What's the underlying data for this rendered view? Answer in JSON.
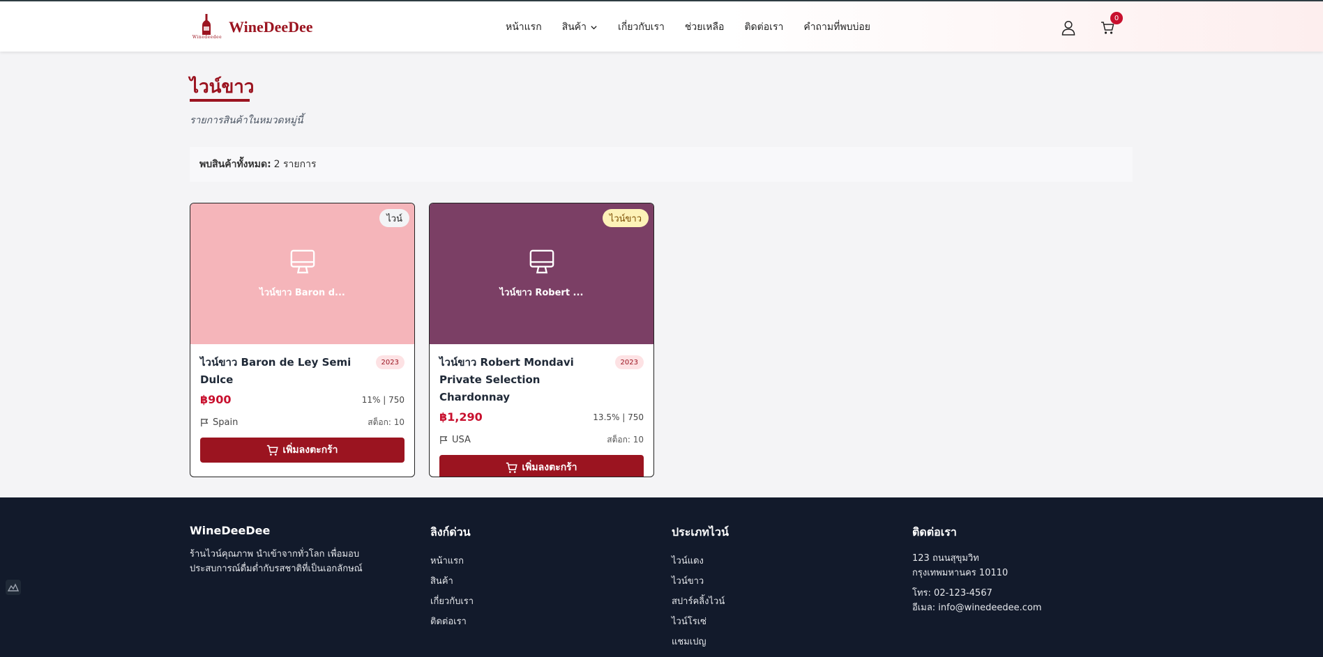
{
  "header": {
    "logo_text": "WineDeeDee",
    "logo_tiny": "Winedeedee",
    "nav": [
      "หน้าแรก",
      "สินค้า",
      "เกี่ยวกับเรา",
      "ช่วยเหลือ",
      "ติดต่อเรา",
      "คำถามที่พบบ่อย"
    ],
    "cart_count": "0"
  },
  "page": {
    "title": "ไวน์ขาว",
    "subtitle": "รายการสินค้าในหมวดหมู่นี้",
    "result_label": "พบสินค้าทั้งหมด:",
    "result_value": "2 รายการ"
  },
  "products": [
    {
      "badge": "ไวน์",
      "image_caption": "ไวน์ขาว Baron d...",
      "name": "ไวน์ขาว Baron de Ley Semi Dulce",
      "year": "2023",
      "price": "฿900",
      "abv": "11% | 750",
      "origin": "Spain",
      "stock": "สต็อก: 10",
      "button": "เพิ่มลงตะกร้า",
      "image_color": "#f5b5ba",
      "badge_bg": "#f3f4f6",
      "badge_color": "#222222"
    },
    {
      "badge": "ไวน์ขาว",
      "image_caption": "ไวน์ขาว Robert ...",
      "name": "ไวน์ขาว Robert Mondavi Private Selection Chardonnay",
      "year": "2023",
      "price": "฿1,290",
      "abv": "13.5% | 750",
      "origin": "USA",
      "stock": "สต็อก: 10",
      "button": "เพิ่มลงตะกร้า",
      "image_color": "#7b3f65",
      "badge_bg": "#fdf2b8",
      "badge_color": "#7a4b00"
    }
  ],
  "footer": {
    "brand": {
      "title": "WineDeeDee",
      "desc": "ร้านไวน์คุณภาพ นำเข้าจากทั่วโลก เพื่อมอบประสบการณ์ดื่มด่ำกับรสชาติที่เป็นเอกลักษณ์"
    },
    "quick_links": {
      "title": "ลิงก์ด่วน",
      "items": [
        "หน้าแรก",
        "สินค้า",
        "เกี่ยวกับเรา",
        "ติดต่อเรา"
      ]
    },
    "wine_types": {
      "title": "ประเภทไวน์",
      "items": [
        "ไวน์แดง",
        "ไวน์ขาว",
        "สปาร์คลิ้งไวน์",
        "ไวน์โรเซ่",
        "แชมเปญ"
      ]
    },
    "contact": {
      "title": "ติดต่อเรา",
      "address1": "123 ถนนสุขุมวิท",
      "address2": "กรุงเทพมหานคร 10110",
      "phone": "โทร: 02-123-4567",
      "email": "อีเมล: info@winedeedee.com"
    }
  },
  "colors": {
    "brand": "#9b1420",
    "footer_bg": "#121a2b",
    "badge_red": "#c8102e"
  }
}
